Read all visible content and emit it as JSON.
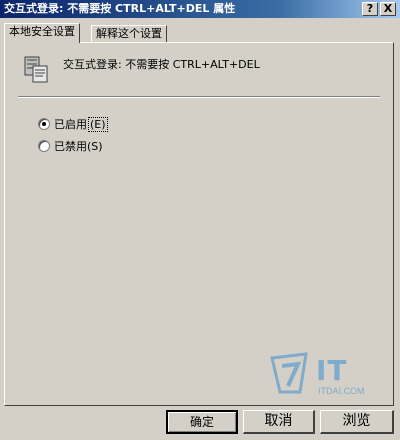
{
  "window": {
    "title": "交互式登录: 不需要按 CTRL+ALT+DEL 属性",
    "help_label": "?",
    "close_label": "X"
  },
  "tabs": [
    {
      "label": "本地安全设置",
      "active": true
    },
    {
      "label": "解释这个设置",
      "active": false
    }
  ],
  "policy": {
    "icon": "computer-policy-icon",
    "title": "交互式登录: 不需要按 CTRL+ALT+DEL"
  },
  "options": [
    {
      "label": "已启用",
      "accel": "E",
      "selected": true
    },
    {
      "label": "已禁用",
      "accel": "S",
      "selected": false
    }
  ],
  "watermark": {
    "brand": "IT",
    "url": "ITDAI.COM"
  },
  "buttons": {
    "ok": "确定",
    "cancel": "取消",
    "browse": "浏览"
  }
}
